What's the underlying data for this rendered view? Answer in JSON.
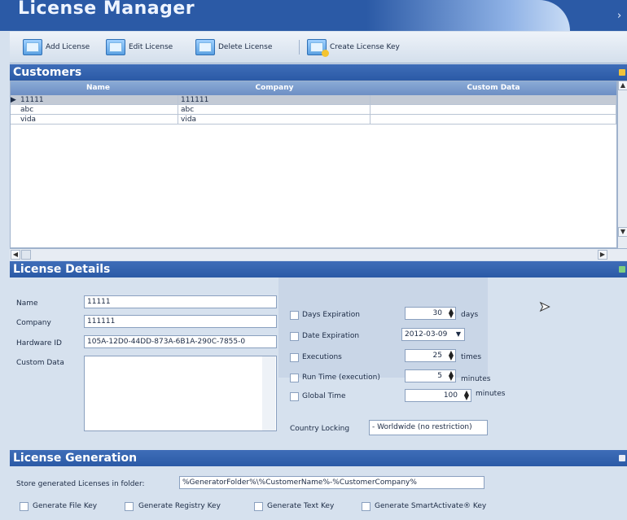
{
  "window": {
    "title": "License Manager",
    "close_glyph": "›"
  },
  "toolbar": {
    "add_license": "Add License",
    "edit_license": "Edit License",
    "delete_license": "Delete License",
    "create_license_key": "Create License Key"
  },
  "customers": {
    "title": "Customers",
    "columns": [
      "Name",
      "Company",
      "Custom Data"
    ],
    "rows": [
      {
        "name": "11111",
        "company": "111111",
        "custom": ""
      },
      {
        "name": "abc",
        "company": "abc",
        "custom": ""
      },
      {
        "name": "vida",
        "company": "vida",
        "custom": ""
      }
    ],
    "selected_index": 0
  },
  "details": {
    "title": "License Details",
    "name_label": "Name",
    "name_value": "11111",
    "company_label": "Company",
    "company_value": "111111",
    "hardware_label": "Hardware ID",
    "hardware_value": "105A-12D0-44DD-873A-6B1A-290C-7855-0",
    "custom_label": "Custom Data",
    "custom_value": "",
    "days_label": "Days Expiration",
    "days_value": "30",
    "days_unit": "days",
    "date_label": "Date Expiration",
    "date_value": "2012-03-09",
    "exec_label": "Executions",
    "exec_value": "25",
    "exec_unit": "times",
    "runtime_label": "Run Time (execution)",
    "runtime_value": "5",
    "runtime_unit": "minutes",
    "global_label": "Global Time",
    "global_value": "100",
    "global_unit": "minutes",
    "country_label": "Country Locking",
    "country_value": "- Worldwide (no restriction)"
  },
  "generation": {
    "title": "License Generation",
    "folder_label": "Store generated Licenses in folder:",
    "folder_value": "%GeneratorFolder%\\%CustomerName%-%CustomerCompany%",
    "file_key": "Generate File Key",
    "registry_key": "Generate Registry Key",
    "text_key": "Generate Text Key",
    "smart_key": "Generate SmartActivate® Key"
  },
  "colors": {
    "accent": "#2b5aa6",
    "header": "#3f6db8",
    "background": "#d6e1ee"
  }
}
